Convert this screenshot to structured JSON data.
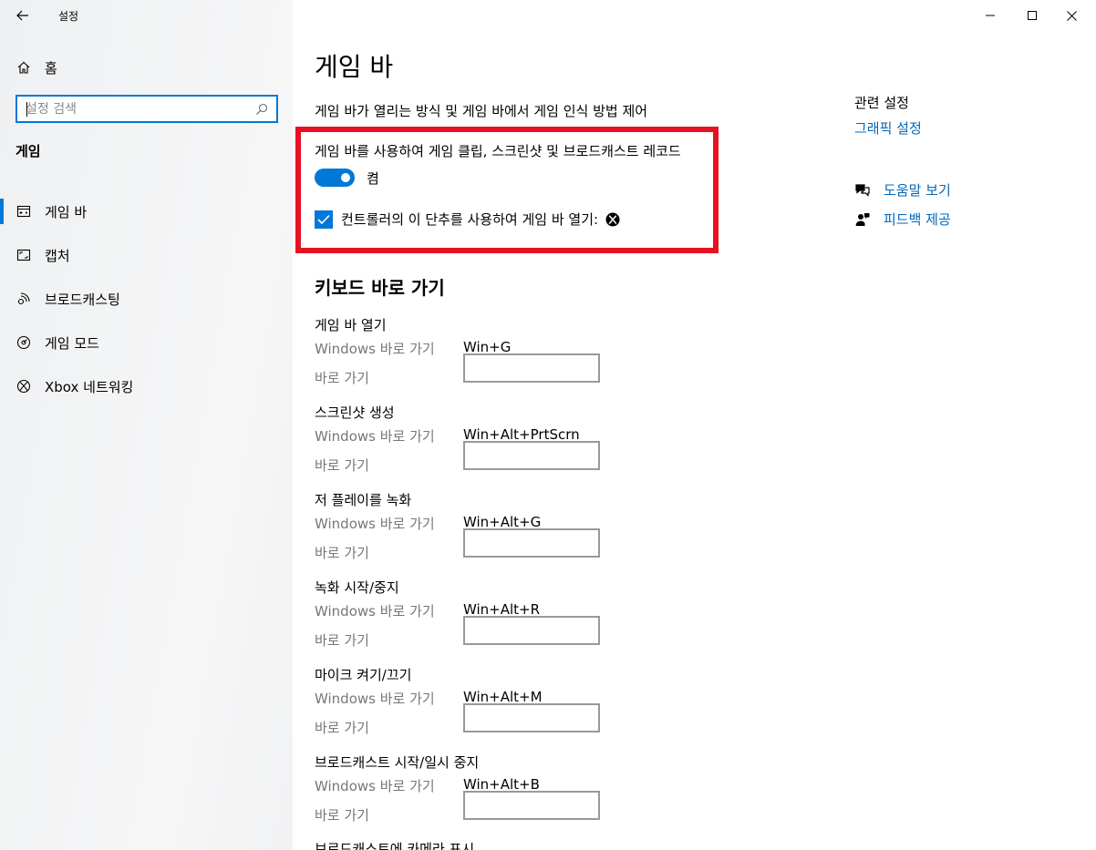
{
  "window": {
    "title": "설정"
  },
  "sidebar": {
    "home_label": "홈",
    "search_placeholder": "설정 검색",
    "section_title": "게임",
    "items": [
      {
        "label": "게임 바",
        "icon": "game-bar-icon",
        "selected": true
      },
      {
        "label": "캡처",
        "icon": "capture-icon",
        "selected": false
      },
      {
        "label": "브로드캐스팅",
        "icon": "broadcast-icon",
        "selected": false
      },
      {
        "label": "게임 모드",
        "icon": "game-mode-icon",
        "selected": false
      },
      {
        "label": "Xbox 네트워킹",
        "icon": "xbox-icon",
        "selected": false
      }
    ]
  },
  "main": {
    "title": "게임 바",
    "description": "게임 바가 열리는 방식 및 게임 바에서 게임 인식 방법 제어",
    "toggle_description": "게임 바를 사용하여 게임 클립, 스크린샷 및 브로드캐스트 레코드",
    "toggle_state": "켬",
    "toggle_on": true,
    "checkbox_label": "컨트롤러의 이 단추를 사용하여 게임 바 열기:",
    "checkbox_checked": true,
    "keyboard_title": "키보드 바로 가기",
    "win_shortcut_label": "Windows 바로 가기",
    "shortcut_label": "바로 가기",
    "shortcuts": [
      {
        "title": "게임 바 열기",
        "windows": "Win+G",
        "custom": ""
      },
      {
        "title": "스크린샷 생성",
        "windows": "Win+Alt+PrtScrn",
        "custom": ""
      },
      {
        "title": "저 플레이를 녹화",
        "windows": "Win+Alt+G",
        "custom": ""
      },
      {
        "title": "녹화 시작/중지",
        "windows": "Win+Alt+R",
        "custom": ""
      },
      {
        "title": "마이크 켜기/끄기",
        "windows": "Win+Alt+M",
        "custom": ""
      },
      {
        "title": "브로드캐스트 시작/일시 중지",
        "windows": "Win+Alt+B",
        "custom": ""
      }
    ],
    "cutoff_title": "브로드캐스트에 카메라 표시"
  },
  "related": {
    "title": "관련 설정",
    "link": "그래픽 설정",
    "help": "도움말 보기",
    "feedback": "피드백 제공"
  },
  "colors": {
    "accent": "#0078d7",
    "link": "#0067b8",
    "highlight": "#e81123"
  }
}
